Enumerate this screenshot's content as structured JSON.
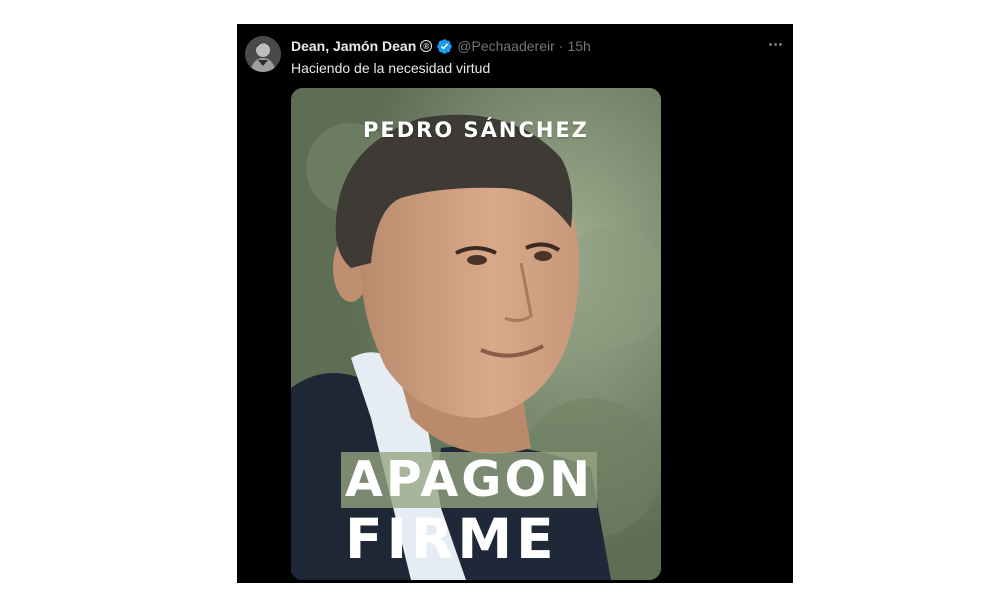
{
  "tweet": {
    "display_name": "Dean, Jamón Dean",
    "reg_symbol": "®",
    "handle": "@Pechaadereir",
    "separator": "·",
    "time": "15h",
    "text": "Haciendo de la necesidad virtud",
    "verified_color": "#1d9bf0",
    "avatar_icon": "avatar-icon",
    "more_icon": "more-options-icon"
  },
  "media": {
    "author": "PEDRO SÁNCHEZ",
    "title_line1": "APAGON",
    "title_line2": "FIRME"
  }
}
